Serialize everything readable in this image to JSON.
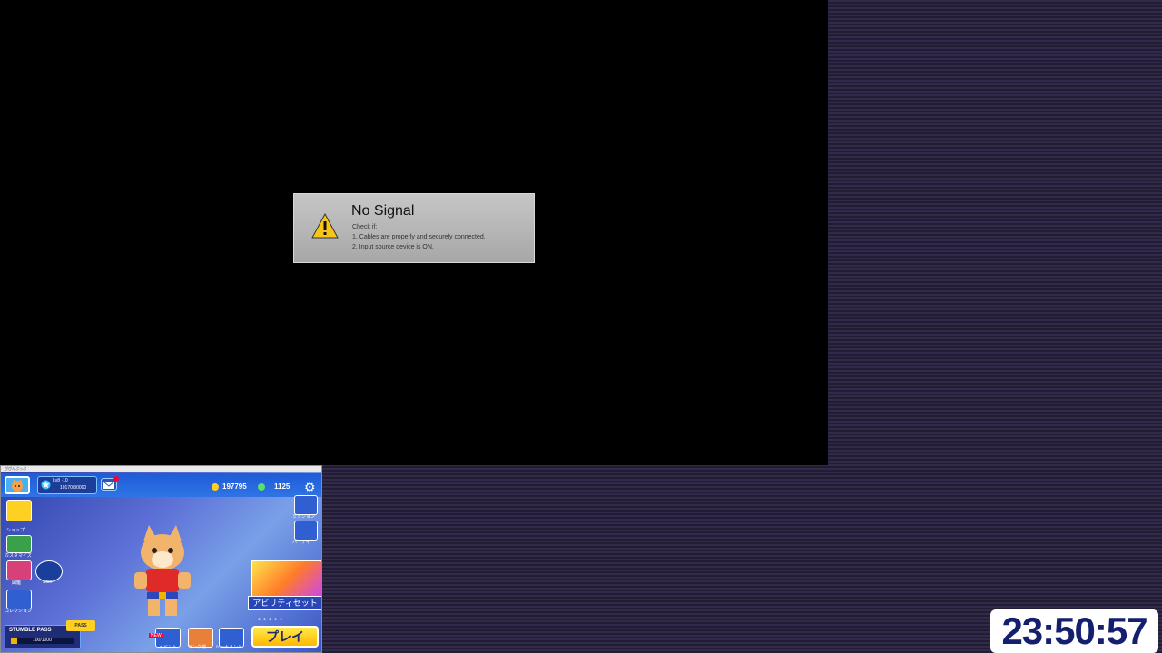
{
  "capture": {
    "title": "No Signal",
    "check_label": "Check if:",
    "line1": "1. Cables are properly and securely connected.",
    "line2": "2. Input source device is ON."
  },
  "game": {
    "window_title": "ぴぴんぷっぷ",
    "level": "Lv8 ·10",
    "xp": "10170/30000",
    "mail_badge": "1",
    "coins": "197795",
    "gems": "1125",
    "left_menu": [
      {
        "label": "ショップ"
      },
      {
        "label": "カスタマイズ"
      },
      {
        "label": "図鑑"
      },
      {
        "label": "Solo"
      },
      {
        "label": "コレクション"
      }
    ],
    "right_menu": [
      {
        "label": "ミッション"
      },
      {
        "label": "パーティー"
      }
    ],
    "ability_label": "アビリティセット",
    "pass_label": "STUMBLE PASS",
    "pass_value": "100/1000",
    "pass_progress": 0.1,
    "bottom_menu": [
      {
        "label": "イベント"
      },
      {
        "label": "ランク戦"
      },
      {
        "label": "トーナメント"
      }
    ],
    "play_label": "プレイ",
    "pass_badge": "PASS",
    "new_badge": "NEW"
  },
  "clock": {
    "time": "23:50:57"
  },
  "colors": {
    "background": "#2b2440",
    "clock_text": "#14206e",
    "play_button": "#ffd024"
  }
}
